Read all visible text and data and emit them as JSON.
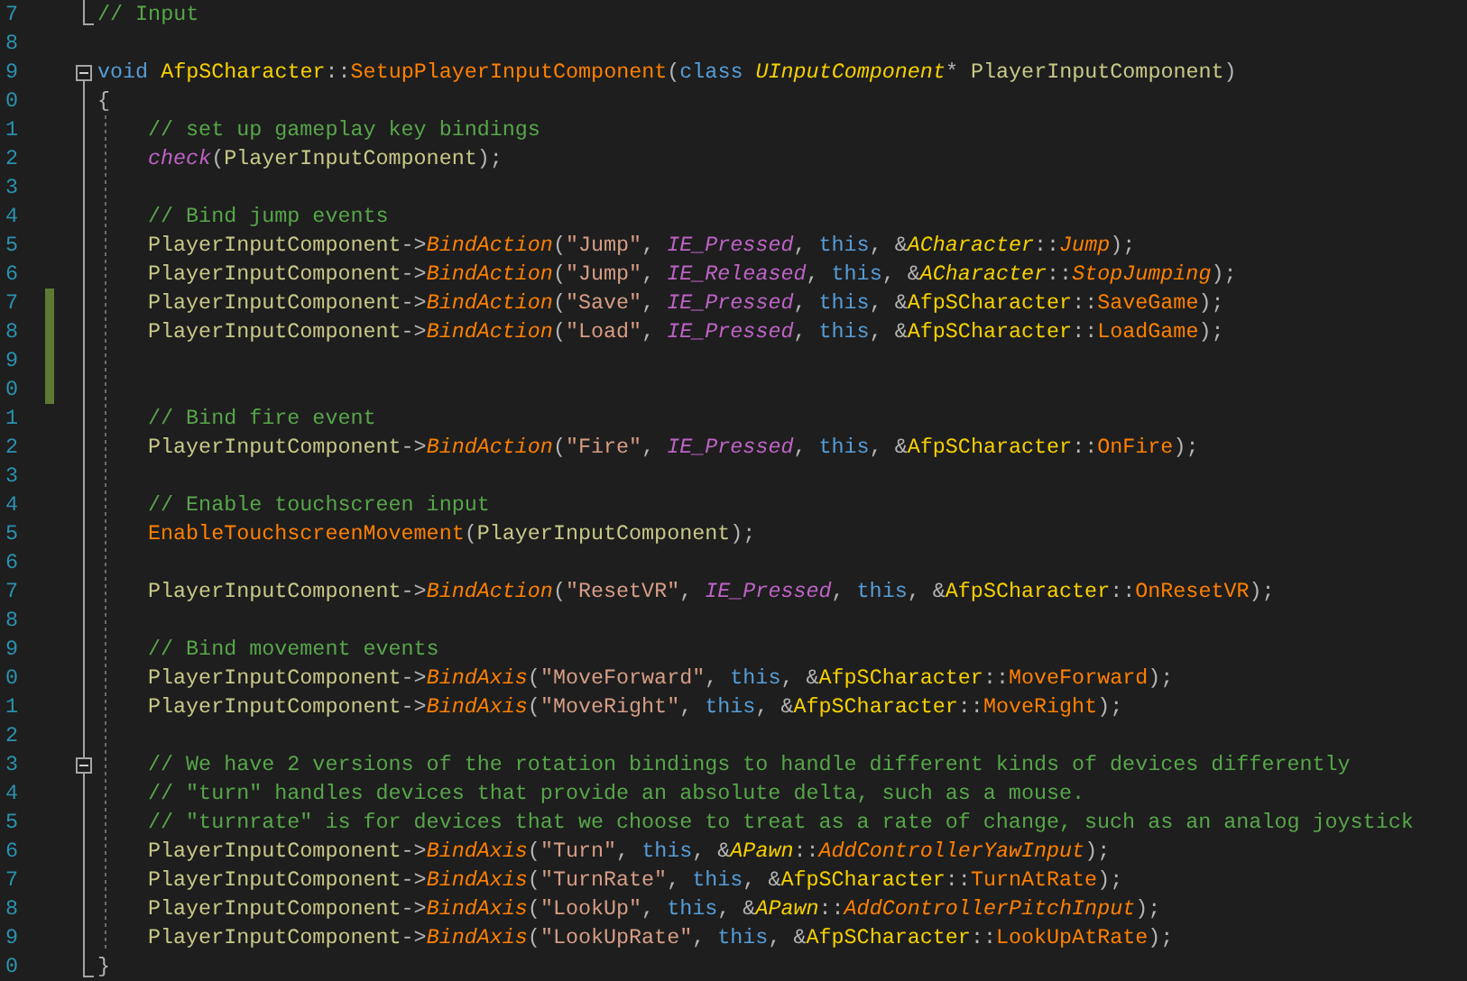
{
  "editor": {
    "lines": [
      {
        "number": "7",
        "fold_toggle": false,
        "fold_line": false,
        "fold_end": true,
        "guide": false,
        "changed": false,
        "tokens": [
          {
            "kind": "comment",
            "text": "// Input"
          }
        ]
      },
      {
        "number": "8",
        "fold_toggle": false,
        "fold_line": false,
        "fold_end": false,
        "guide": false,
        "changed": false
      },
      {
        "number": "9",
        "fold_toggle": true,
        "fold_line": false,
        "fold_end": false,
        "guide": false,
        "changed": false,
        "tokens": [
          {
            "kind": "keyword",
            "text": "void "
          },
          {
            "kind": "type",
            "text": "AfpSCharacter"
          },
          {
            "kind": "punct",
            "text": "::"
          },
          {
            "kind": "func",
            "text": "SetupPlayerInputComponent"
          },
          {
            "kind": "punct",
            "text": "("
          },
          {
            "kind": "keyword",
            "text": "class "
          },
          {
            "kind": "type-italic",
            "text": "UInputComponent"
          },
          {
            "kind": "punct",
            "text": "* "
          },
          {
            "kind": "param",
            "text": "PlayerInputComponent"
          },
          {
            "kind": "punct",
            "text": ")"
          }
        ]
      },
      {
        "number": "0",
        "fold_toggle": false,
        "fold_line": true,
        "fold_end": false,
        "guide": false,
        "changed": false,
        "tokens": [
          {
            "kind": "punct",
            "text": "{"
          }
        ]
      },
      {
        "number": "1",
        "fold_toggle": false,
        "fold_line": true,
        "fold_end": false,
        "guide": true,
        "changed": false,
        "tokens": [
          {
            "kind": "comment",
            "text": "// set up gameplay key bindings"
          }
        ]
      },
      {
        "number": "2",
        "fold_toggle": false,
        "fold_line": true,
        "fold_end": false,
        "guide": true,
        "changed": false,
        "tokens": [
          {
            "kind": "macro",
            "text": "check"
          },
          {
            "kind": "punct",
            "text": "("
          },
          {
            "kind": "param",
            "text": "PlayerInputComponent"
          },
          {
            "kind": "punct",
            "text": ");"
          }
        ]
      },
      {
        "number": "3",
        "fold_toggle": false,
        "fold_line": true,
        "fold_end": false,
        "guide": true,
        "changed": false
      },
      {
        "number": "4",
        "fold_toggle": false,
        "fold_line": true,
        "fold_end": false,
        "guide": true,
        "changed": false,
        "tokens": [
          {
            "kind": "comment",
            "text": "// Bind jump events"
          }
        ]
      },
      {
        "number": "5",
        "fold_toggle": false,
        "fold_line": true,
        "fold_end": false,
        "guide": true,
        "changed": false,
        "tokens": [
          {
            "kind": "param",
            "text": "PlayerInputComponent"
          },
          {
            "kind": "punct",
            "text": "->"
          },
          {
            "kind": "func-italic",
            "text": "BindAction"
          },
          {
            "kind": "punct",
            "text": "("
          },
          {
            "kind": "string",
            "text": "\"Jump\""
          },
          {
            "kind": "punct",
            "text": ", "
          },
          {
            "kind": "macro",
            "text": "IE_Pressed"
          },
          {
            "kind": "punct",
            "text": ", "
          },
          {
            "kind": "keyword",
            "text": "this"
          },
          {
            "kind": "punct",
            "text": ", &"
          },
          {
            "kind": "type-italic",
            "text": "ACharacter"
          },
          {
            "kind": "punct",
            "text": "::"
          },
          {
            "kind": "func-italic",
            "text": "Jump"
          },
          {
            "kind": "punct",
            "text": ");"
          }
        ]
      },
      {
        "number": "6",
        "fold_toggle": false,
        "fold_line": true,
        "fold_end": false,
        "guide": true,
        "changed": false,
        "tokens": [
          {
            "kind": "param",
            "text": "PlayerInputComponent"
          },
          {
            "kind": "punct",
            "text": "->"
          },
          {
            "kind": "func-italic",
            "text": "BindAction"
          },
          {
            "kind": "punct",
            "text": "("
          },
          {
            "kind": "string",
            "text": "\"Jump\""
          },
          {
            "kind": "punct",
            "text": ", "
          },
          {
            "kind": "macro",
            "text": "IE_Released"
          },
          {
            "kind": "punct",
            "text": ", "
          },
          {
            "kind": "keyword",
            "text": "this"
          },
          {
            "kind": "punct",
            "text": ", &"
          },
          {
            "kind": "type-italic",
            "text": "ACharacter"
          },
          {
            "kind": "punct",
            "text": "::"
          },
          {
            "kind": "func-italic",
            "text": "StopJumping"
          },
          {
            "kind": "punct",
            "text": ");"
          }
        ]
      },
      {
        "number": "7",
        "fold_toggle": false,
        "fold_line": true,
        "fold_end": false,
        "guide": true,
        "changed": true,
        "tokens": [
          {
            "kind": "param",
            "text": "PlayerInputComponent"
          },
          {
            "kind": "punct",
            "text": "->"
          },
          {
            "kind": "func-italic",
            "text": "BindAction"
          },
          {
            "kind": "punct",
            "text": "("
          },
          {
            "kind": "string",
            "text": "\"Save\""
          },
          {
            "kind": "punct",
            "text": ", "
          },
          {
            "kind": "macro",
            "text": "IE_Pressed"
          },
          {
            "kind": "punct",
            "text": ", "
          },
          {
            "kind": "keyword",
            "text": "this"
          },
          {
            "kind": "punct",
            "text": ", &"
          },
          {
            "kind": "type",
            "text": "AfpSCharacter"
          },
          {
            "kind": "punct",
            "text": "::"
          },
          {
            "kind": "func",
            "text": "SaveGame"
          },
          {
            "kind": "punct",
            "text": ");"
          }
        ]
      },
      {
        "number": "8",
        "fold_toggle": false,
        "fold_line": true,
        "fold_end": false,
        "guide": true,
        "changed": true,
        "tokens": [
          {
            "kind": "param",
            "text": "PlayerInputComponent"
          },
          {
            "kind": "punct",
            "text": "->"
          },
          {
            "kind": "func-italic",
            "text": "BindAction"
          },
          {
            "kind": "punct",
            "text": "("
          },
          {
            "kind": "string",
            "text": "\"Load\""
          },
          {
            "kind": "punct",
            "text": ", "
          },
          {
            "kind": "macro",
            "text": "IE_Pressed"
          },
          {
            "kind": "punct",
            "text": ", "
          },
          {
            "kind": "keyword",
            "text": "this"
          },
          {
            "kind": "punct",
            "text": ", &"
          },
          {
            "kind": "type",
            "text": "AfpSCharacter"
          },
          {
            "kind": "punct",
            "text": "::"
          },
          {
            "kind": "func",
            "text": "LoadGame"
          },
          {
            "kind": "punct",
            "text": ");"
          }
        ]
      },
      {
        "number": "9",
        "fold_toggle": false,
        "fold_line": true,
        "fold_end": false,
        "guide": true,
        "changed": true
      },
      {
        "number": "0",
        "fold_toggle": false,
        "fold_line": true,
        "fold_end": false,
        "guide": true,
        "changed": true
      },
      {
        "number": "1",
        "fold_toggle": false,
        "fold_line": true,
        "fold_end": false,
        "guide": true,
        "changed": false,
        "tokens": [
          {
            "kind": "comment",
            "text": "// Bind fire event"
          }
        ]
      },
      {
        "number": "2",
        "fold_toggle": false,
        "fold_line": true,
        "fold_end": false,
        "guide": true,
        "changed": false,
        "tokens": [
          {
            "kind": "param",
            "text": "PlayerInputComponent"
          },
          {
            "kind": "punct",
            "text": "->"
          },
          {
            "kind": "func-italic",
            "text": "BindAction"
          },
          {
            "kind": "punct",
            "text": "("
          },
          {
            "kind": "string",
            "text": "\"Fire\""
          },
          {
            "kind": "punct",
            "text": ", "
          },
          {
            "kind": "macro",
            "text": "IE_Pressed"
          },
          {
            "kind": "punct",
            "text": ", "
          },
          {
            "kind": "keyword",
            "text": "this"
          },
          {
            "kind": "punct",
            "text": ", &"
          },
          {
            "kind": "type",
            "text": "AfpSCharacter"
          },
          {
            "kind": "punct",
            "text": "::"
          },
          {
            "kind": "func",
            "text": "OnFire"
          },
          {
            "kind": "punct",
            "text": ");"
          }
        ]
      },
      {
        "number": "3",
        "fold_toggle": false,
        "fold_line": true,
        "fold_end": false,
        "guide": true,
        "changed": false
      },
      {
        "number": "4",
        "fold_toggle": false,
        "fold_line": true,
        "fold_end": false,
        "guide": true,
        "changed": false,
        "tokens": [
          {
            "kind": "comment",
            "text": "// Enable touchscreen input"
          }
        ]
      },
      {
        "number": "5",
        "fold_toggle": false,
        "fold_line": true,
        "fold_end": false,
        "guide": true,
        "changed": false,
        "tokens": [
          {
            "kind": "func",
            "text": "EnableTouchscreenMovement"
          },
          {
            "kind": "punct",
            "text": "("
          },
          {
            "kind": "param",
            "text": "PlayerInputComponent"
          },
          {
            "kind": "punct",
            "text": ");"
          }
        ]
      },
      {
        "number": "6",
        "fold_toggle": false,
        "fold_line": true,
        "fold_end": false,
        "guide": true,
        "changed": false
      },
      {
        "number": "7",
        "fold_toggle": false,
        "fold_line": true,
        "fold_end": false,
        "guide": true,
        "changed": false,
        "tokens": [
          {
            "kind": "param",
            "text": "PlayerInputComponent"
          },
          {
            "kind": "punct",
            "text": "->"
          },
          {
            "kind": "func-italic",
            "text": "BindAction"
          },
          {
            "kind": "punct",
            "text": "("
          },
          {
            "kind": "string",
            "text": "\"ResetVR\""
          },
          {
            "kind": "punct",
            "text": ", "
          },
          {
            "kind": "macro",
            "text": "IE_Pressed"
          },
          {
            "kind": "punct",
            "text": ", "
          },
          {
            "kind": "keyword",
            "text": "this"
          },
          {
            "kind": "punct",
            "text": ", &"
          },
          {
            "kind": "type",
            "text": "AfpSCharacter"
          },
          {
            "kind": "punct",
            "text": "::"
          },
          {
            "kind": "func",
            "text": "OnResetVR"
          },
          {
            "kind": "punct",
            "text": ");"
          }
        ]
      },
      {
        "number": "8",
        "fold_toggle": false,
        "fold_line": true,
        "fold_end": false,
        "guide": true,
        "changed": false
      },
      {
        "number": "9",
        "fold_toggle": false,
        "fold_line": true,
        "fold_end": false,
        "guide": true,
        "changed": false,
        "tokens": [
          {
            "kind": "comment",
            "text": "// Bind movement events"
          }
        ]
      },
      {
        "number": "0",
        "fold_toggle": false,
        "fold_line": true,
        "fold_end": false,
        "guide": true,
        "changed": false,
        "tokens": [
          {
            "kind": "param",
            "text": "PlayerInputComponent"
          },
          {
            "kind": "punct",
            "text": "->"
          },
          {
            "kind": "func-italic",
            "text": "BindAxis"
          },
          {
            "kind": "punct",
            "text": "("
          },
          {
            "kind": "string",
            "text": "\"MoveForward\""
          },
          {
            "kind": "punct",
            "text": ", "
          },
          {
            "kind": "keyword",
            "text": "this"
          },
          {
            "kind": "punct",
            "text": ", &"
          },
          {
            "kind": "type",
            "text": "AfpSCharacter"
          },
          {
            "kind": "punct",
            "text": "::"
          },
          {
            "kind": "func",
            "text": "MoveForward"
          },
          {
            "kind": "punct",
            "text": ");"
          }
        ]
      },
      {
        "number": "1",
        "fold_toggle": false,
        "fold_line": true,
        "fold_end": false,
        "guide": true,
        "changed": false,
        "tokens": [
          {
            "kind": "param",
            "text": "PlayerInputComponent"
          },
          {
            "kind": "punct",
            "text": "->"
          },
          {
            "kind": "func-italic",
            "text": "BindAxis"
          },
          {
            "kind": "punct",
            "text": "("
          },
          {
            "kind": "string",
            "text": "\"MoveRight\""
          },
          {
            "kind": "punct",
            "text": ", "
          },
          {
            "kind": "keyword",
            "text": "this"
          },
          {
            "kind": "punct",
            "text": ", &"
          },
          {
            "kind": "type",
            "text": "AfpSCharacter"
          },
          {
            "kind": "punct",
            "text": "::"
          },
          {
            "kind": "func",
            "text": "MoveRight"
          },
          {
            "kind": "punct",
            "text": ");"
          }
        ]
      },
      {
        "number": "2",
        "fold_toggle": false,
        "fold_line": true,
        "fold_end": false,
        "guide": true,
        "changed": false
      },
      {
        "number": "3",
        "fold_toggle": true,
        "fold_line": true,
        "fold_end": false,
        "guide": true,
        "changed": false,
        "tokens": [
          {
            "kind": "comment",
            "text": "// We have 2 versions of the rotation bindings to handle different kinds of devices differently"
          }
        ]
      },
      {
        "number": "4",
        "fold_toggle": false,
        "fold_line": true,
        "fold_end": false,
        "guide": true,
        "changed": false,
        "tokens": [
          {
            "kind": "comment",
            "text": "// \"turn\" handles devices that provide an absolute delta, such as a mouse."
          }
        ]
      },
      {
        "number": "5",
        "fold_toggle": false,
        "fold_line": true,
        "fold_end": false,
        "guide": true,
        "changed": false,
        "tokens": [
          {
            "kind": "comment",
            "text": "// \"turnrate\" is for devices that we choose to treat as a rate of change, such as an analog joystick"
          }
        ]
      },
      {
        "number": "6",
        "fold_toggle": false,
        "fold_line": true,
        "fold_end": false,
        "guide": true,
        "changed": false,
        "tokens": [
          {
            "kind": "param",
            "text": "PlayerInputComponent"
          },
          {
            "kind": "punct",
            "text": "->"
          },
          {
            "kind": "func-italic",
            "text": "BindAxis"
          },
          {
            "kind": "punct",
            "text": "("
          },
          {
            "kind": "string",
            "text": "\"Turn\""
          },
          {
            "kind": "punct",
            "text": ", "
          },
          {
            "kind": "keyword",
            "text": "this"
          },
          {
            "kind": "punct",
            "text": ", &"
          },
          {
            "kind": "type-italic",
            "text": "APawn"
          },
          {
            "kind": "punct",
            "text": "::"
          },
          {
            "kind": "func-italic",
            "text": "AddControllerYawInput"
          },
          {
            "kind": "punct",
            "text": ");"
          }
        ]
      },
      {
        "number": "7",
        "fold_toggle": false,
        "fold_line": true,
        "fold_end": false,
        "guide": true,
        "changed": false,
        "tokens": [
          {
            "kind": "param",
            "text": "PlayerInputComponent"
          },
          {
            "kind": "punct",
            "text": "->"
          },
          {
            "kind": "func-italic",
            "text": "BindAxis"
          },
          {
            "kind": "punct",
            "text": "("
          },
          {
            "kind": "string",
            "text": "\"TurnRate\""
          },
          {
            "kind": "punct",
            "text": ", "
          },
          {
            "kind": "keyword",
            "text": "this"
          },
          {
            "kind": "punct",
            "text": ", &"
          },
          {
            "kind": "type",
            "text": "AfpSCharacter"
          },
          {
            "kind": "punct",
            "text": "::"
          },
          {
            "kind": "func",
            "text": "TurnAtRate"
          },
          {
            "kind": "punct",
            "text": ");"
          }
        ]
      },
      {
        "number": "8",
        "fold_toggle": false,
        "fold_line": true,
        "fold_end": false,
        "guide": true,
        "changed": false,
        "tokens": [
          {
            "kind": "param",
            "text": "PlayerInputComponent"
          },
          {
            "kind": "punct",
            "text": "->"
          },
          {
            "kind": "func-italic",
            "text": "BindAxis"
          },
          {
            "kind": "punct",
            "text": "("
          },
          {
            "kind": "string",
            "text": "\"LookUp\""
          },
          {
            "kind": "punct",
            "text": ", "
          },
          {
            "kind": "keyword",
            "text": "this"
          },
          {
            "kind": "punct",
            "text": ", &"
          },
          {
            "kind": "type-italic",
            "text": "APawn"
          },
          {
            "kind": "punct",
            "text": "::"
          },
          {
            "kind": "func-italic",
            "text": "AddControllerPitchInput"
          },
          {
            "kind": "punct",
            "text": ");"
          }
        ]
      },
      {
        "number": "9",
        "fold_toggle": false,
        "fold_line": true,
        "fold_end": false,
        "guide": true,
        "changed": false,
        "tokens": [
          {
            "kind": "param",
            "text": "PlayerInputComponent"
          },
          {
            "kind": "punct",
            "text": "->"
          },
          {
            "kind": "func-italic",
            "text": "BindAxis"
          },
          {
            "kind": "punct",
            "text": "("
          },
          {
            "kind": "string",
            "text": "\"LookUpRate\""
          },
          {
            "kind": "punct",
            "text": ", "
          },
          {
            "kind": "keyword",
            "text": "this"
          },
          {
            "kind": "punct",
            "text": ", &"
          },
          {
            "kind": "type",
            "text": "AfpSCharacter"
          },
          {
            "kind": "punct",
            "text": "::"
          },
          {
            "kind": "func",
            "text": "LookUpAtRate"
          },
          {
            "kind": "punct",
            "text": ");"
          }
        ]
      },
      {
        "number": "0",
        "fold_toggle": false,
        "fold_line": false,
        "fold_end": true,
        "guide": false,
        "changed": false,
        "tokens": [
          {
            "kind": "punct",
            "text": "}"
          }
        ]
      }
    ]
  }
}
